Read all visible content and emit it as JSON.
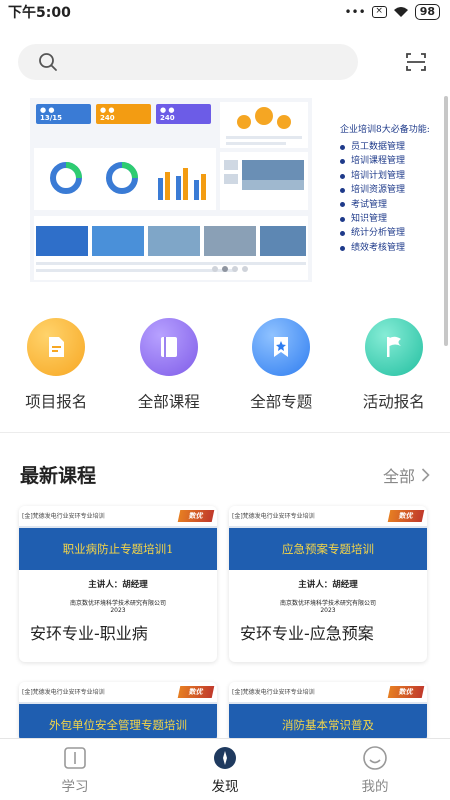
{
  "status_bar": {
    "time": "下午5:00",
    "battery": "98"
  },
  "search": {
    "placeholder": ""
  },
  "banner": {
    "feature_title": "企业培训8大必备功能:",
    "features": [
      "员工数据管理",
      "培训课程管理",
      "培训计划管理",
      "培训资源管理",
      "考试管理",
      "知识管理",
      "统计分析管理",
      "绩效考核管理"
    ],
    "dashboard": {
      "stat1": "13/15",
      "stat2": "240",
      "stat3": "240"
    }
  },
  "quick_links": [
    {
      "label": "项目报名",
      "icon": "file-icon",
      "color": "#f7b733"
    },
    {
      "label": "全部课程",
      "icon": "book-icon",
      "color": "#8f6ff0"
    },
    {
      "label": "全部专题",
      "icon": "star-bookmark-icon",
      "color": "#3f8ef7"
    },
    {
      "label": "活动报名",
      "icon": "flag-icon",
      "color": "#2fc8a8"
    }
  ],
  "latest_courses": {
    "title": "最新课程",
    "more_label": "全部",
    "courses": [
      {
        "header": "[金]梵德发电行业安环专业培训",
        "logo": "数优",
        "banner_title": "职业病防止专题培训1",
        "speaker": "主讲人：胡经理",
        "org": "南京数优环境科学技术研究有限公司",
        "year": "2023",
        "title": "安环专业-职业病"
      },
      {
        "header": "[金]梵德发电行业安环专业培训",
        "logo": "数优",
        "banner_title": "应急预案专题培训",
        "speaker": "主讲人：胡经理",
        "org": "南京数优环境科学技术研究有限公司",
        "year": "2023",
        "title": "安环专业-应急预案"
      },
      {
        "header": "[金]梵德发电行业安环专业培训",
        "logo": "数优",
        "banner_title": "外包单位安全管理专题培训",
        "speaker": "",
        "org": "",
        "year": "",
        "title": ""
      },
      {
        "header": "[金]梵德发电行业安环专业培训",
        "logo": "数优",
        "banner_title": "消防基本常识普及",
        "speaker": "",
        "org": "",
        "year": "",
        "title": ""
      }
    ]
  },
  "bottom_nav": [
    {
      "label": "学习",
      "icon": "book-open-icon",
      "active": false
    },
    {
      "label": "发现",
      "icon": "compass-icon",
      "active": true
    },
    {
      "label": "我的",
      "icon": "smile-icon",
      "active": false
    }
  ]
}
